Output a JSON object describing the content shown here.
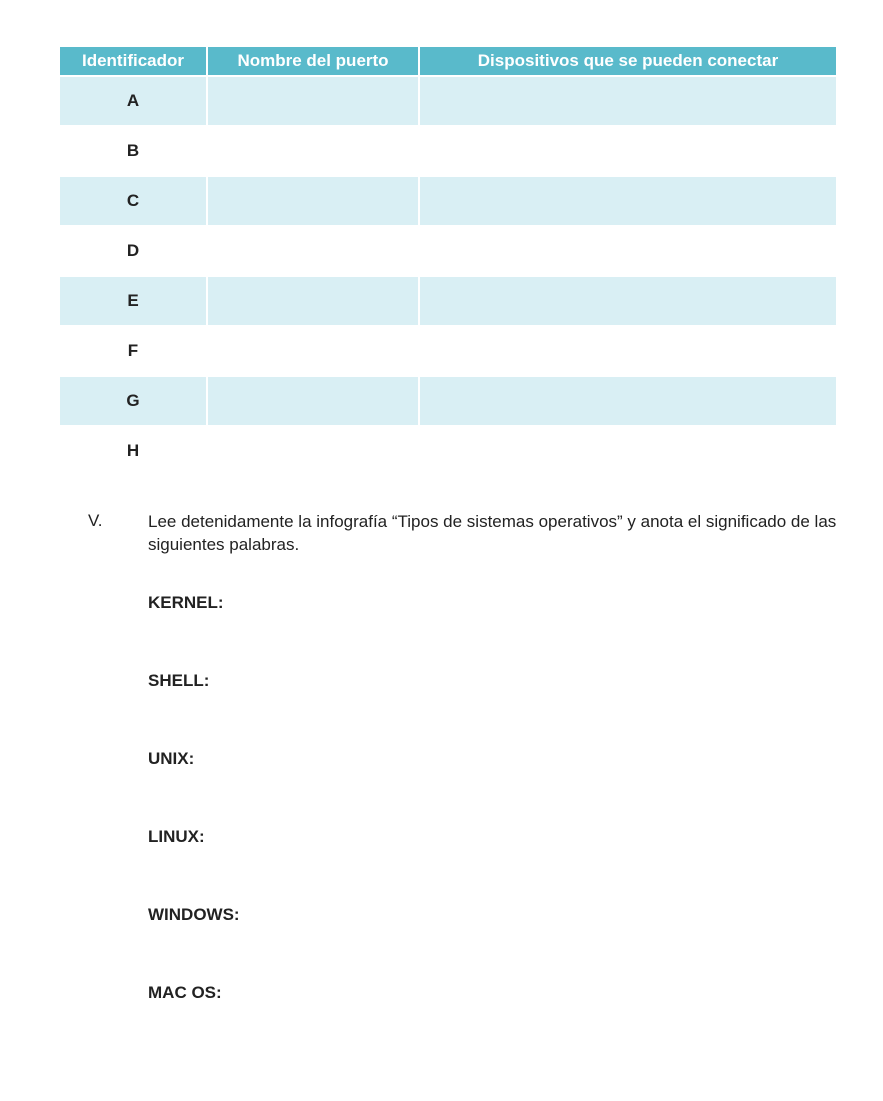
{
  "table": {
    "headers": {
      "col1": "Identificador",
      "col2": "Nombre del puerto",
      "col3": "Dispositivos que se pueden conectar"
    },
    "rows": [
      {
        "id": "A",
        "nombre": "",
        "dispositivos": ""
      },
      {
        "id": "B",
        "nombre": "",
        "dispositivos": ""
      },
      {
        "id": "C",
        "nombre": "",
        "dispositivos": ""
      },
      {
        "id": "D",
        "nombre": "",
        "dispositivos": ""
      },
      {
        "id": "E",
        "nombre": "",
        "dispositivos": ""
      },
      {
        "id": "F",
        "nombre": "",
        "dispositivos": ""
      },
      {
        "id": "G",
        "nombre": "",
        "dispositivos": ""
      },
      {
        "id": "H",
        "nombre": "",
        "dispositivos": ""
      }
    ]
  },
  "item_v": {
    "numeral": "V.",
    "text": "Lee detenidamente la infografía “Tipos de sistemas operativos” y anota el significado de las siguientes palabras."
  },
  "terms": [
    "KERNEL:",
    "SHELL:",
    "UNIX:",
    "LINUX:",
    "WINDOWS:",
    "MAC OS:"
  ]
}
